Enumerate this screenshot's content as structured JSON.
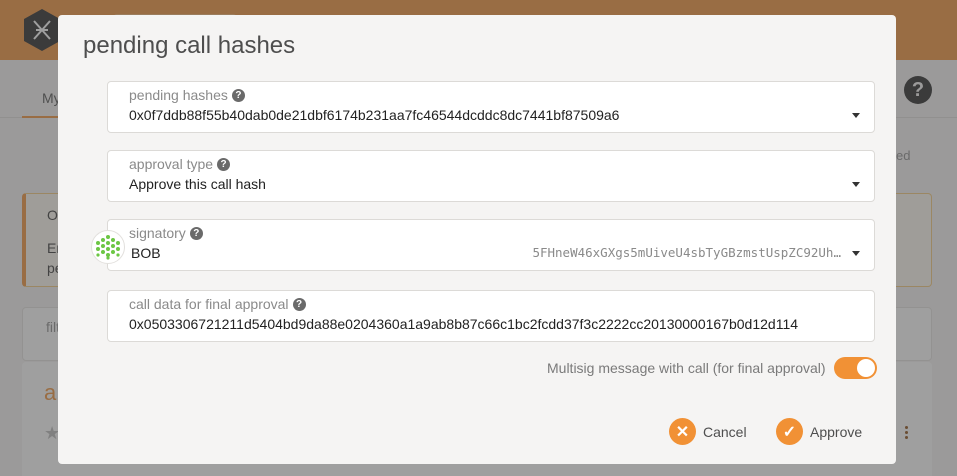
{
  "background": {
    "subnav_tab": "My",
    "help_icon": "?",
    "right_hint": "ed",
    "warning_line_1": "O",
    "warning_line_2": "Er",
    "warning_line_3": "pe",
    "filter_placeholder": "filt",
    "card_title": "a"
  },
  "modal": {
    "title": "pending call hashes",
    "pending_hashes": {
      "label": "pending hashes",
      "value": "0x0f7ddb88f55b40dab0de21dbf6174b231aa7fc46544dcddc8dc7441bf87509a6"
    },
    "approval_type": {
      "label": "approval type",
      "value": "Approve this call hash"
    },
    "signatory": {
      "label": "signatory",
      "name": "BOB",
      "address": "5FHneW46xGXgs5mUiveU4sbTyGBzmstUspZC92Uh…"
    },
    "call_data": {
      "label": "call data for final approval",
      "value": "0x0503306721211d5404bd9da88e0204360a1a9ab8b87c66c1bc2fcdd37f3c2222cc20130000167b0d12d114"
    },
    "toggle": {
      "label": "Multisig message with call (for final approval)",
      "on": true
    },
    "buttons": {
      "cancel": "Cancel",
      "approve": "Approve"
    }
  },
  "icons": {
    "help": "question-circle-icon",
    "dropdown": "caret-down-icon",
    "cancel": "times-icon",
    "approve": "check-icon",
    "identicon": "polkadot-identicon"
  },
  "colors": {
    "accent": "#f19135",
    "modal_bg": "#f5f4f3",
    "identicon": "#6cc644"
  }
}
